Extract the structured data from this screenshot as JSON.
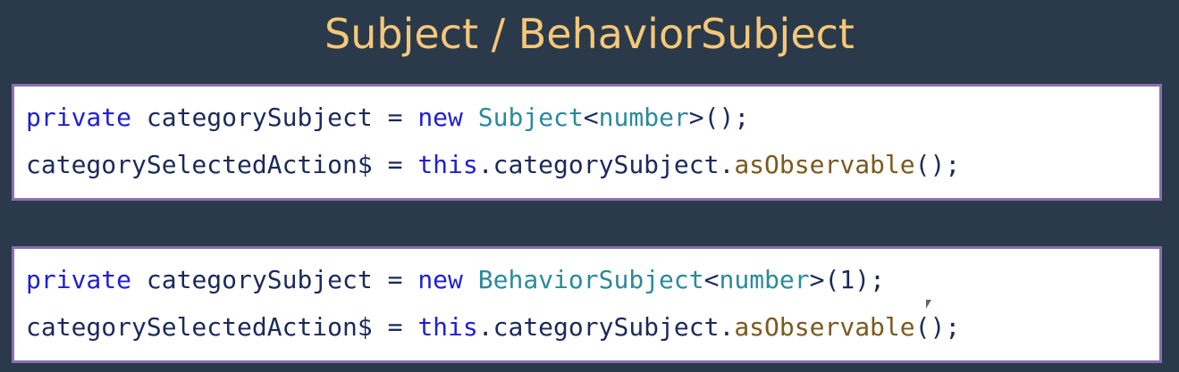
{
  "slide": {
    "title": "Subject / BehaviorSubject"
  },
  "code_blocks": [
    {
      "line1": {
        "kw_private": "private",
        "var": "categorySubject",
        "eq": "=",
        "kw_new": "new",
        "type": "Subject",
        "generic_open": "<",
        "generic_type": "number",
        "generic_close": ">",
        "args": "();"
      },
      "line2": {
        "var": "categorySelectedAction$",
        "eq": "=",
        "kw_this": "this",
        "member": ".categorySubject.",
        "method": "asObservable",
        "args": "();"
      }
    },
    {
      "line1": {
        "kw_private": "private",
        "var": "categorySubject",
        "eq": "=",
        "kw_new": "new",
        "type": "BehaviorSubject",
        "generic_open": "<",
        "generic_type": "number",
        "generic_close": ">",
        "args": "(1);"
      },
      "line2": {
        "var": "categorySelectedAction$",
        "eq": "=",
        "kw_this": "this",
        "member": ".categorySubject.",
        "method": "asObservable",
        "args": "();"
      }
    }
  ],
  "colors": {
    "background": "#2a3a4a",
    "title": "#f5c77a",
    "box_border": "#8b6fb0",
    "keyword": "#1f1fd6",
    "identifier": "#1b2a5a",
    "type": "#2b8a9a",
    "method": "#7a5a1e"
  },
  "icons": {
    "cursor": "mouse-pointer-icon"
  }
}
